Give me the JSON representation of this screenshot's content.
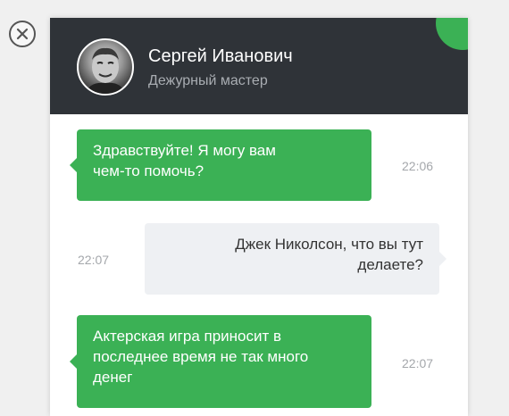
{
  "close": {
    "icon": "close-icon"
  },
  "agent": {
    "name": "Сергей Иванович",
    "role": "Дежурный мастер",
    "avatar_icon": "avatar-photo"
  },
  "colors": {
    "header_bg": "#2f3338",
    "accent": "#3bb155",
    "user_bubble_bg": "#eef0f3"
  },
  "messages": [
    {
      "from": "agent",
      "lines": [
        "Здравствуйте! Я могу вам",
        "чем-то помочь?"
      ],
      "time": "22:06"
    },
    {
      "from": "user",
      "lines": [
        "Джек Николсон, что вы тут",
        "делаете?"
      ],
      "time": "22:07"
    },
    {
      "from": "agent",
      "lines": [
        "Актерская игра приносит в",
        "последнее время не так много",
        "денег"
      ],
      "time": "22:07"
    }
  ]
}
